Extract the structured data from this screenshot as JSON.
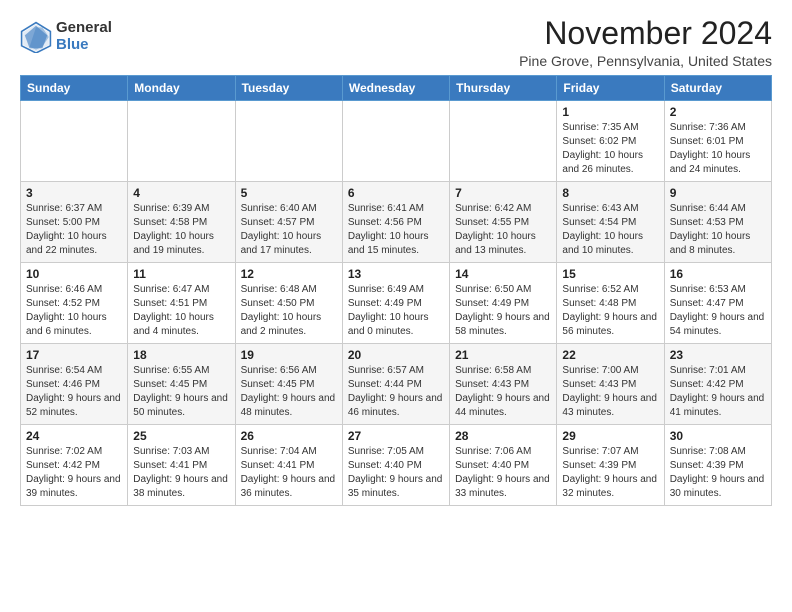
{
  "logo": {
    "general": "General",
    "blue": "Blue"
  },
  "title": "November 2024",
  "location": "Pine Grove, Pennsylvania, United States",
  "headers": [
    "Sunday",
    "Monday",
    "Tuesday",
    "Wednesday",
    "Thursday",
    "Friday",
    "Saturday"
  ],
  "weeks": [
    [
      {
        "day": "",
        "content": ""
      },
      {
        "day": "",
        "content": ""
      },
      {
        "day": "",
        "content": ""
      },
      {
        "day": "",
        "content": ""
      },
      {
        "day": "",
        "content": ""
      },
      {
        "day": "1",
        "content": "Sunrise: 7:35 AM\nSunset: 6:02 PM\nDaylight: 10 hours and 26 minutes."
      },
      {
        "day": "2",
        "content": "Sunrise: 7:36 AM\nSunset: 6:01 PM\nDaylight: 10 hours and 24 minutes."
      }
    ],
    [
      {
        "day": "3",
        "content": "Sunrise: 6:37 AM\nSunset: 5:00 PM\nDaylight: 10 hours and 22 minutes."
      },
      {
        "day": "4",
        "content": "Sunrise: 6:39 AM\nSunset: 4:58 PM\nDaylight: 10 hours and 19 minutes."
      },
      {
        "day": "5",
        "content": "Sunrise: 6:40 AM\nSunset: 4:57 PM\nDaylight: 10 hours and 17 minutes."
      },
      {
        "day": "6",
        "content": "Sunrise: 6:41 AM\nSunset: 4:56 PM\nDaylight: 10 hours and 15 minutes."
      },
      {
        "day": "7",
        "content": "Sunrise: 6:42 AM\nSunset: 4:55 PM\nDaylight: 10 hours and 13 minutes."
      },
      {
        "day": "8",
        "content": "Sunrise: 6:43 AM\nSunset: 4:54 PM\nDaylight: 10 hours and 10 minutes."
      },
      {
        "day": "9",
        "content": "Sunrise: 6:44 AM\nSunset: 4:53 PM\nDaylight: 10 hours and 8 minutes."
      }
    ],
    [
      {
        "day": "10",
        "content": "Sunrise: 6:46 AM\nSunset: 4:52 PM\nDaylight: 10 hours and 6 minutes."
      },
      {
        "day": "11",
        "content": "Sunrise: 6:47 AM\nSunset: 4:51 PM\nDaylight: 10 hours and 4 minutes."
      },
      {
        "day": "12",
        "content": "Sunrise: 6:48 AM\nSunset: 4:50 PM\nDaylight: 10 hours and 2 minutes."
      },
      {
        "day": "13",
        "content": "Sunrise: 6:49 AM\nSunset: 4:49 PM\nDaylight: 10 hours and 0 minutes."
      },
      {
        "day": "14",
        "content": "Sunrise: 6:50 AM\nSunset: 4:49 PM\nDaylight: 9 hours and 58 minutes."
      },
      {
        "day": "15",
        "content": "Sunrise: 6:52 AM\nSunset: 4:48 PM\nDaylight: 9 hours and 56 minutes."
      },
      {
        "day": "16",
        "content": "Sunrise: 6:53 AM\nSunset: 4:47 PM\nDaylight: 9 hours and 54 minutes."
      }
    ],
    [
      {
        "day": "17",
        "content": "Sunrise: 6:54 AM\nSunset: 4:46 PM\nDaylight: 9 hours and 52 minutes."
      },
      {
        "day": "18",
        "content": "Sunrise: 6:55 AM\nSunset: 4:45 PM\nDaylight: 9 hours and 50 minutes."
      },
      {
        "day": "19",
        "content": "Sunrise: 6:56 AM\nSunset: 4:45 PM\nDaylight: 9 hours and 48 minutes."
      },
      {
        "day": "20",
        "content": "Sunrise: 6:57 AM\nSunset: 4:44 PM\nDaylight: 9 hours and 46 minutes."
      },
      {
        "day": "21",
        "content": "Sunrise: 6:58 AM\nSunset: 4:43 PM\nDaylight: 9 hours and 44 minutes."
      },
      {
        "day": "22",
        "content": "Sunrise: 7:00 AM\nSunset: 4:43 PM\nDaylight: 9 hours and 43 minutes."
      },
      {
        "day": "23",
        "content": "Sunrise: 7:01 AM\nSunset: 4:42 PM\nDaylight: 9 hours and 41 minutes."
      }
    ],
    [
      {
        "day": "24",
        "content": "Sunrise: 7:02 AM\nSunset: 4:42 PM\nDaylight: 9 hours and 39 minutes."
      },
      {
        "day": "25",
        "content": "Sunrise: 7:03 AM\nSunset: 4:41 PM\nDaylight: 9 hours and 38 minutes."
      },
      {
        "day": "26",
        "content": "Sunrise: 7:04 AM\nSunset: 4:41 PM\nDaylight: 9 hours and 36 minutes."
      },
      {
        "day": "27",
        "content": "Sunrise: 7:05 AM\nSunset: 4:40 PM\nDaylight: 9 hours and 35 minutes."
      },
      {
        "day": "28",
        "content": "Sunrise: 7:06 AM\nSunset: 4:40 PM\nDaylight: 9 hours and 33 minutes."
      },
      {
        "day": "29",
        "content": "Sunrise: 7:07 AM\nSunset: 4:39 PM\nDaylight: 9 hours and 32 minutes."
      },
      {
        "day": "30",
        "content": "Sunrise: 7:08 AM\nSunset: 4:39 PM\nDaylight: 9 hours and 30 minutes."
      }
    ]
  ]
}
